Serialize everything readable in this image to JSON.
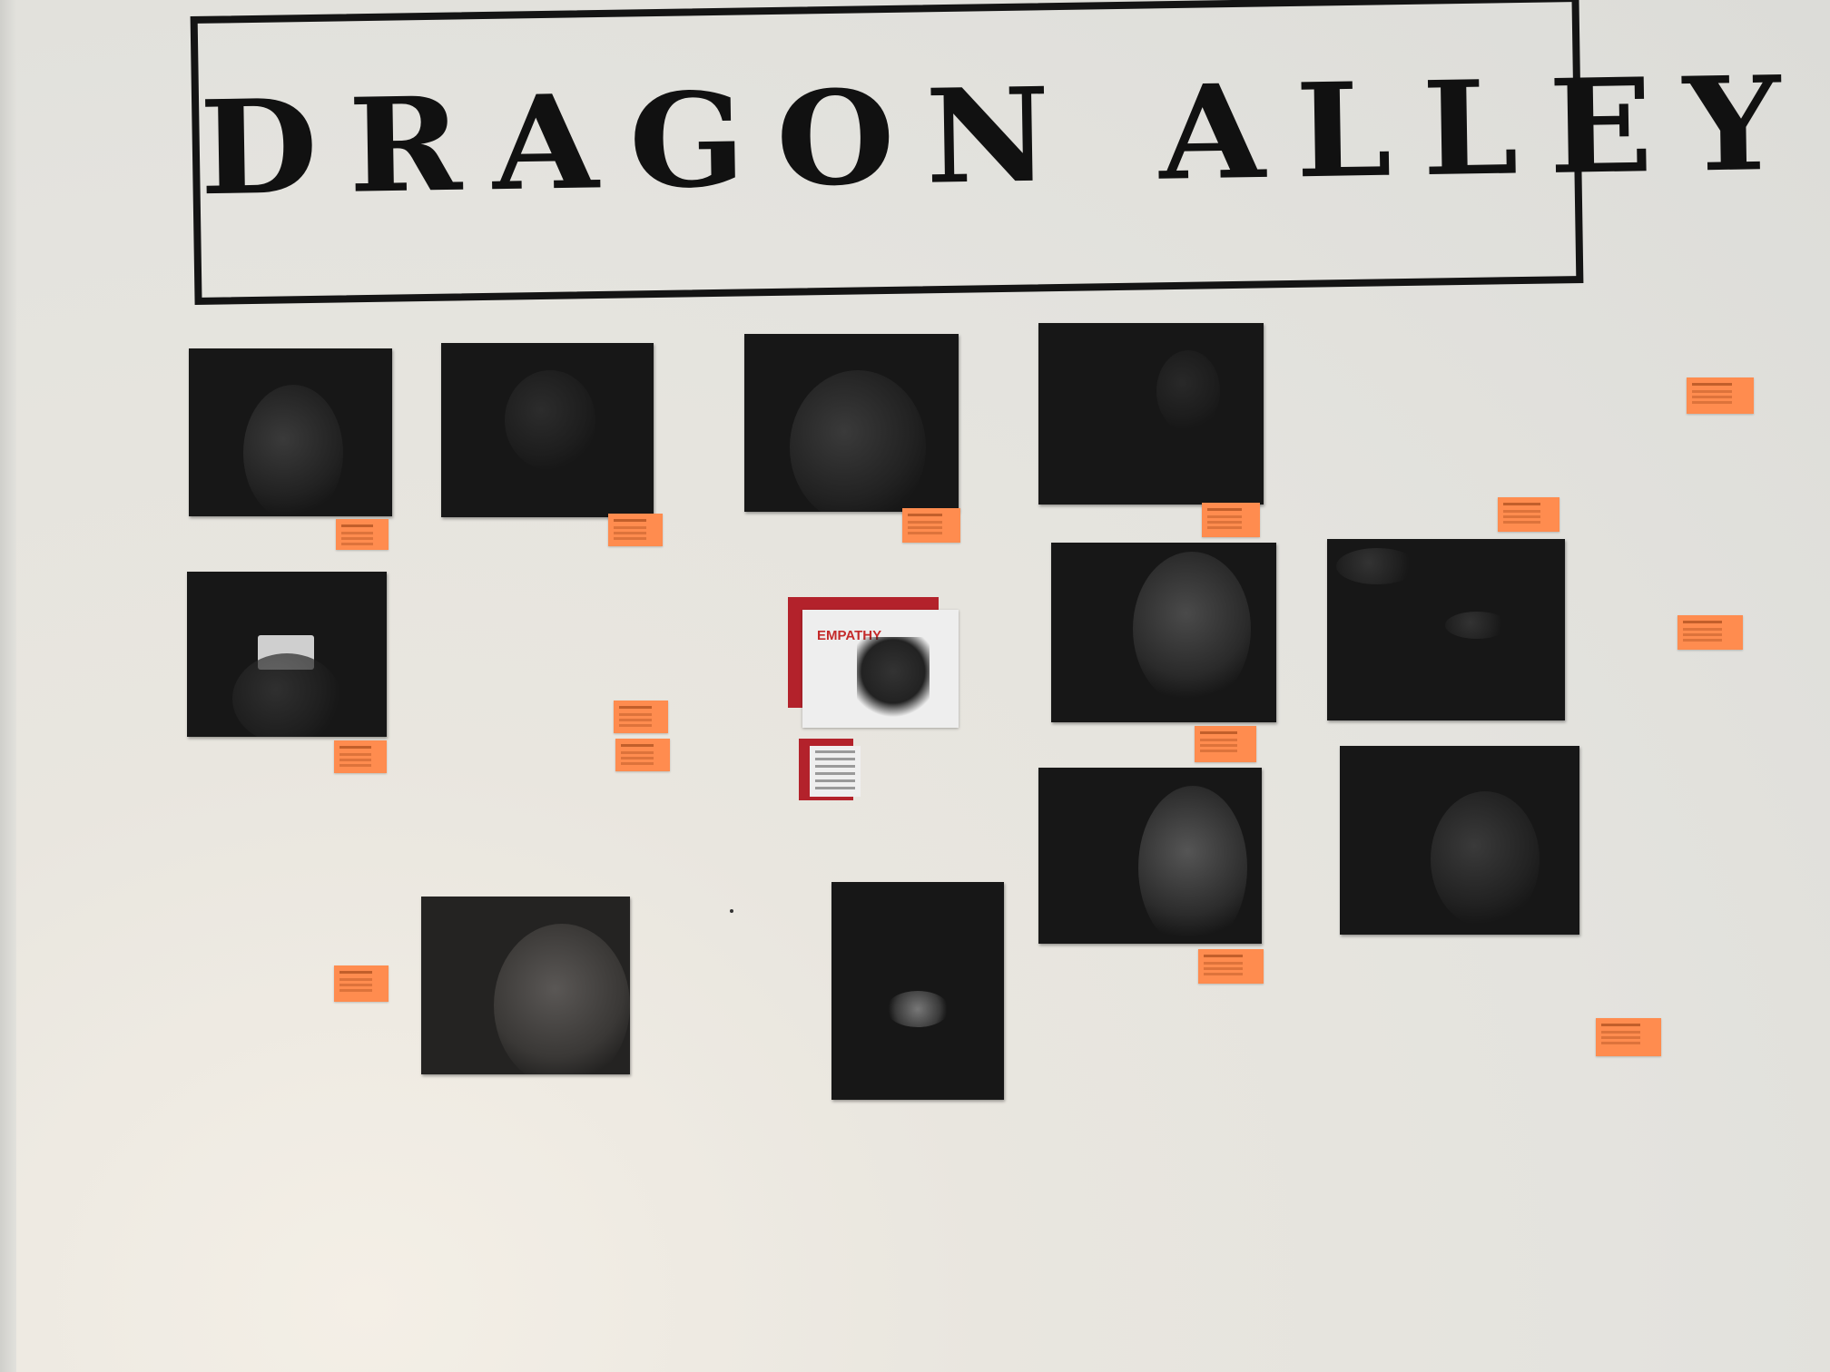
{
  "header": {
    "title": "DRAGON ALLEY"
  },
  "colors": {
    "wall": "#e4e3de",
    "frame": "#141414",
    "photo": "#171717",
    "note": "#ff8c4f",
    "accent_red": "#b3222b"
  },
  "feature": {
    "poster_word": "EMPATHY"
  }
}
